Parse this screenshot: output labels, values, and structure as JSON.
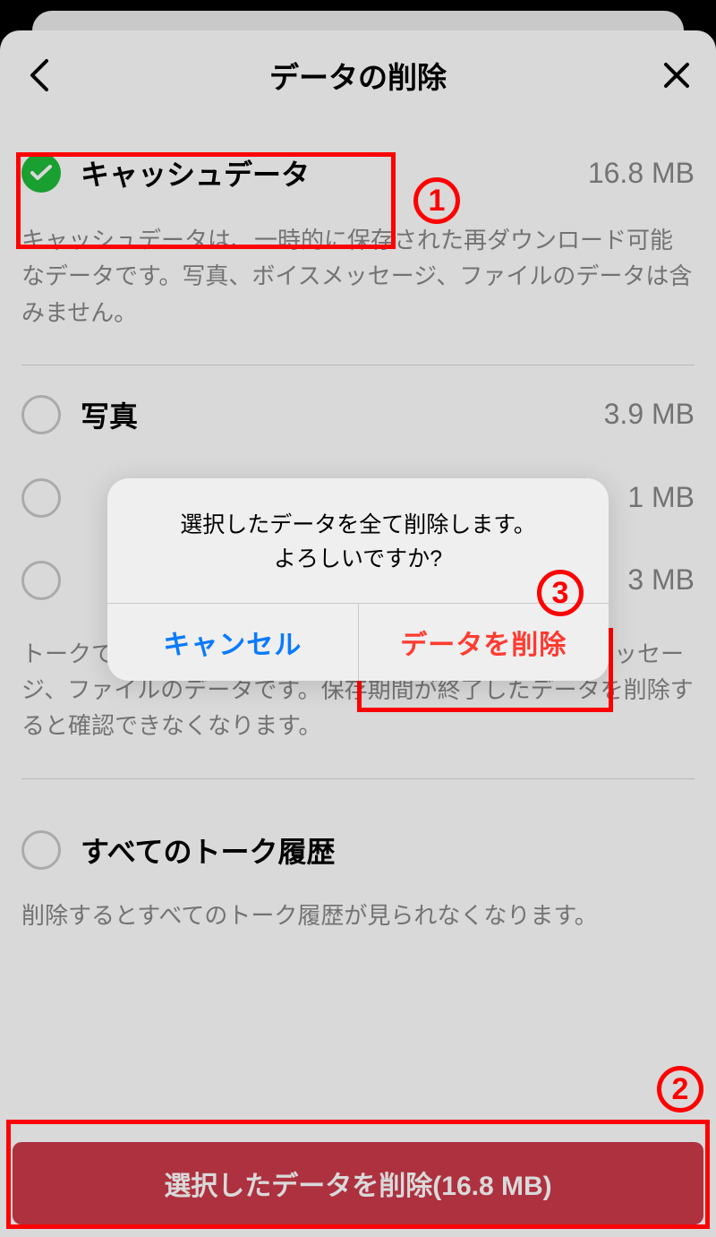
{
  "header": {
    "title": "データの削除"
  },
  "section_cache": {
    "label": "キャッシュデータ",
    "size": "16.8 MB",
    "desc": "キャッシュデータは、一時的に保存された再ダウンロード可能なデータです。写真、ボイスメッセージ、ファイルのデータは含みません。"
  },
  "section_media": {
    "items": [
      {
        "label": "写真",
        "size": "3.9 MB"
      },
      {
        "label": "",
        "size": "1 MB"
      },
      {
        "label": "",
        "size": "3 MB"
      }
    ],
    "desc": "トークで送受信された写真（アルバムを除く）、ボイスメッセージ、ファイルのデータです。保存期間が終了したデータを削除すると確認できなくなります。"
  },
  "section_history": {
    "label": "すべてのトーク履歴",
    "desc": "削除するとすべてのトーク履歴が見られなくなります。"
  },
  "delete_button": {
    "label": "選択したデータを削除(16.8 MB)"
  },
  "dialog": {
    "line1": "選択したデータを全て削除します。",
    "line2": "よろしいですか?",
    "cancel": "キャンセル",
    "confirm": "データを削除"
  },
  "annotations": {
    "a1": "1",
    "a2": "2",
    "a3": "3"
  }
}
